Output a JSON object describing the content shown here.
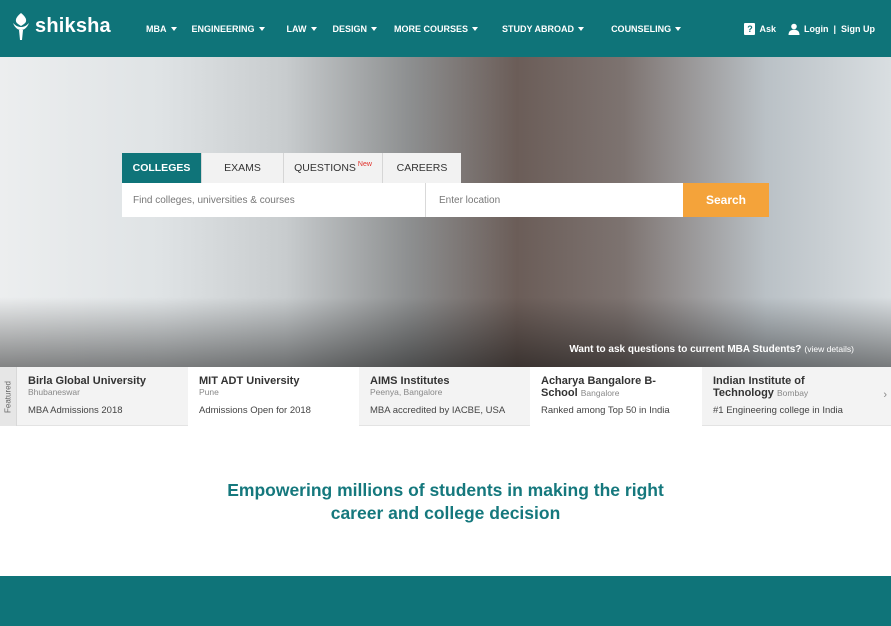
{
  "brand": {
    "name": "shiksha",
    "accent": "#0f7479",
    "search_color": "#f4a33a"
  },
  "nav": {
    "items": [
      {
        "label": "MBA"
      },
      {
        "label": "ENGINEERING"
      },
      {
        "label": "LAW"
      },
      {
        "label": "DESIGN"
      },
      {
        "label": "MORE COURSES"
      },
      {
        "label": "STUDY ABROAD"
      },
      {
        "label": "COUNSELING"
      }
    ]
  },
  "header": {
    "ask": "Ask",
    "ask_icon": "?",
    "login": "Login",
    "separator": "|",
    "signup": "Sign Up"
  },
  "search": {
    "tabs": [
      {
        "label": "COLLEGES",
        "badge": ""
      },
      {
        "label": "EXAMS",
        "badge": ""
      },
      {
        "label": "QUESTIONS",
        "badge": "New"
      },
      {
        "label": "CAREERS",
        "badge": ""
      }
    ],
    "query_placeholder": "Find colleges, universities & courses",
    "location_placeholder": "Enter location",
    "button": "Search"
  },
  "hero": {
    "note": "Want to ask questions to current MBA Students?",
    "details": "(view details)"
  },
  "featured": {
    "label": "Featured",
    "cards": [
      {
        "name": "Birla Global University",
        "location": "Bhubaneswar",
        "desc": "MBA Admissions 2018"
      },
      {
        "name": "MIT ADT University",
        "location": "Pune",
        "desc": "Admissions Open for 2018"
      },
      {
        "name": "AIMS Institutes",
        "location": "Peenya, Bangalore",
        "desc": "MBA accredited by IACBE, USA"
      },
      {
        "name": "Acharya Bangalore B-School",
        "location": "Bangalore",
        "desc": "Ranked among Top 50 in India"
      },
      {
        "name": "Indian Institute of Technology",
        "location": "Bombay",
        "desc": "#1 Engineering college in India"
      }
    ],
    "next_arrow": "›"
  },
  "tagline": {
    "line1": "Empowering millions of students in making the right",
    "line2": "career and college decision"
  }
}
